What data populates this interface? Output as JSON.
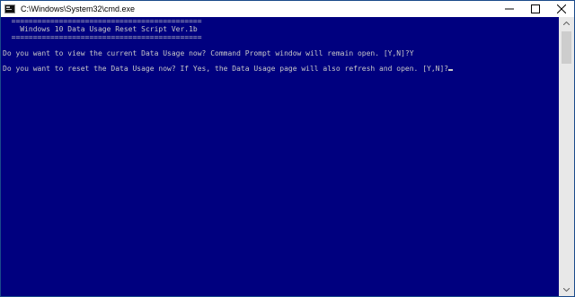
{
  "window": {
    "title": "C:\\Windows\\System32\\cmd.exe",
    "icon": "cmd-icon",
    "controls": [
      "minimize-icon",
      "maximize-icon",
      "close-icon"
    ]
  },
  "console": {
    "lines": [
      "  ============================================",
      "    Windows 10 Data Usage Reset Script Ver.1b",
      "  ============================================",
      "",
      "Do you want to view the current Data Usage now? Command Prompt window will remain open. [Y,N]?Y",
      "",
      "Do you want to reset the Data Usage now? If Yes, the Data Usage page will also refresh and open. [Y,N]?"
    ],
    "background": "#00007f",
    "foreground": "#c8c8c8"
  }
}
